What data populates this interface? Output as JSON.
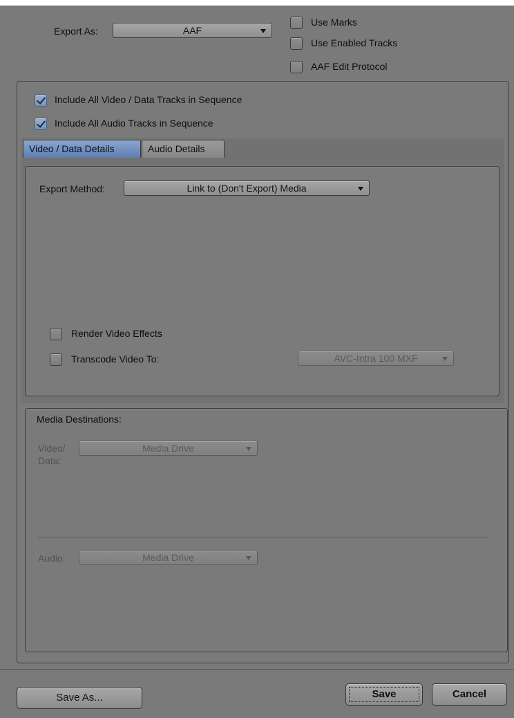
{
  "export_as": {
    "label": "Export As:",
    "value": "AAF"
  },
  "options": {
    "use_marks": {
      "label": "Use Marks",
      "checked": false
    },
    "use_enabled_tracks": {
      "label": "Use Enabled Tracks",
      "checked": false
    },
    "aaf_edit_protocol": {
      "label": "AAF Edit Protocol",
      "checked": false
    }
  },
  "tracks": {
    "include_video": {
      "label": "Include All Video / Data Tracks in Sequence",
      "checked": true
    },
    "include_audio": {
      "label": "Include All Audio Tracks in Sequence",
      "checked": true
    }
  },
  "tabs": [
    {
      "label": "Video / Data Details",
      "active": true
    },
    {
      "label": "Audio Details",
      "active": false
    }
  ],
  "video_details": {
    "export_method_label": "Export Method:",
    "export_method_value": "Link to (Don't Export) Media",
    "render_effects": {
      "label": "Render Video Effects",
      "checked": false
    },
    "transcode": {
      "label": "Transcode Video To:",
      "checked": false
    },
    "transcode_format": "AVC-Intra 100 MXF"
  },
  "media_destinations": {
    "title": "Media Destinations:",
    "video_label_1": "Video/",
    "video_label_2": "Data:",
    "video_value": "Media Drive",
    "audio_label": "Audio:",
    "audio_value": "Media Drive"
  },
  "footer": {
    "save_as": "Save As...",
    "save": "Save",
    "cancel": "Cancel"
  },
  "colors": {
    "window_bg": "#7a7a7a",
    "tab_active": "#6f8dbf",
    "checkbox_checked": "#8aa3c8"
  }
}
